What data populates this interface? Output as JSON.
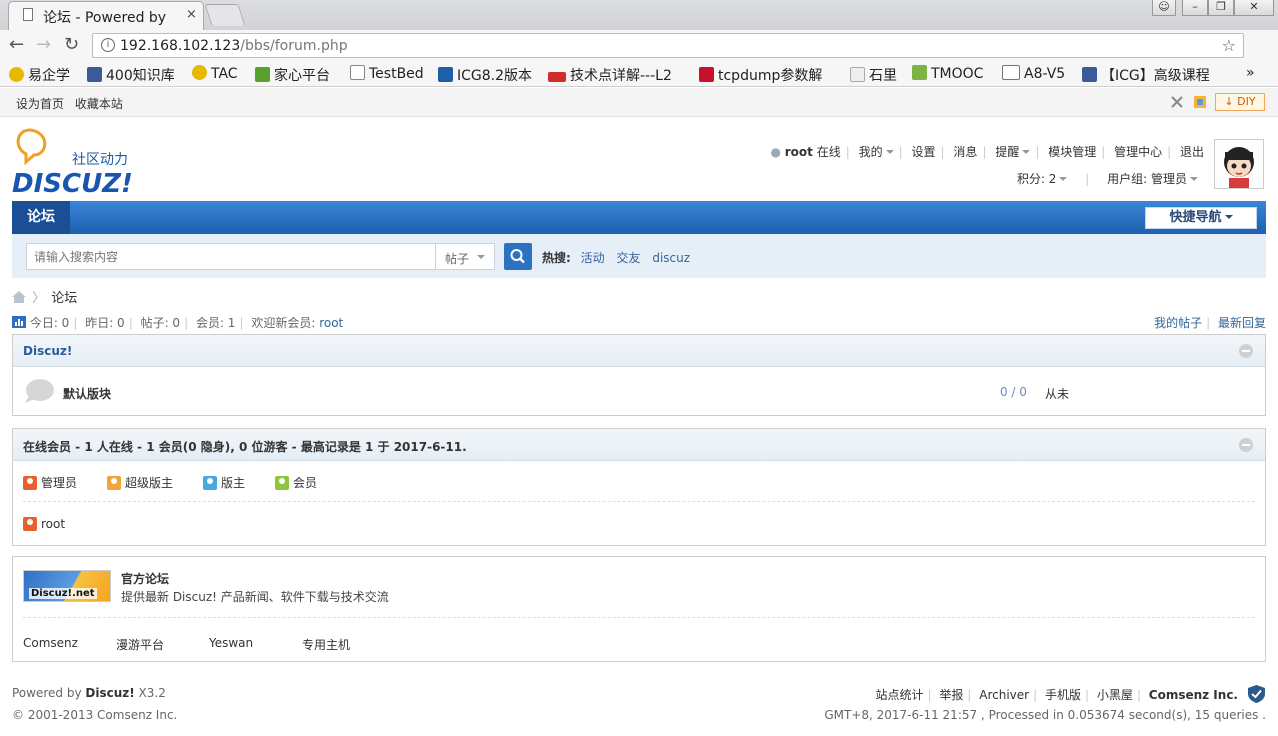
{
  "browser": {
    "tab_title": "论坛 - Powered by",
    "tab_close": "×",
    "url_host": "192.168.102.123",
    "url_path": "/bbs/forum.php",
    "bookmarks": [
      "易企学",
      "400知识库",
      "TAC",
      "家心平台",
      "TestBed",
      "ICG8.2版本",
      "技术点详解---L2",
      "tcpdump参数解",
      "石里",
      "TMOOC",
      "A8-V5",
      "【ICG】高级课程"
    ],
    "bookmark_more": "»"
  },
  "topstrip": {
    "set_home": "设为首页",
    "bookmark_site": "收藏本站",
    "diy": "DIY"
  },
  "logo": {
    "tagline": "社区动力",
    "wordmark": "DISCUZ!"
  },
  "user_nav": {
    "username": "root",
    "online": "在线",
    "items": [
      "我的",
      "设置",
      "消息",
      "提醒",
      "模块管理",
      "管理中心",
      "退出"
    ],
    "credits": "积分: 2",
    "usergroup": "用户组: 管理员"
  },
  "navbar": {
    "current": "论坛",
    "quick_nav": "快捷导航"
  },
  "search": {
    "placeholder": "请输入搜索内容",
    "type": "帖子",
    "hot_label": "热搜:",
    "hot": [
      "活动",
      "交友",
      "discuz"
    ]
  },
  "breadcrumb": {
    "current": "论坛",
    "sep": "〉"
  },
  "stats": {
    "today": "今日: 0",
    "yesterday": "昨日: 0",
    "posts": "帖子: 0",
    "members": "会员: 1",
    "new_member_label": "欢迎新会员: ",
    "new_member": "root"
  },
  "right_links": [
    "我的帖子",
    "最新回复"
  ],
  "category": {
    "title": "Discuz!",
    "forum_name": "默认版块",
    "forum_count": "0 / 0",
    "forum_last": "从未"
  },
  "online": {
    "title": "在线会员 - 1 人在线 - 1 会员(0 隐身), 0 位游客 - 最高记录是 1 于 2017-6-11.",
    "legend": [
      {
        "label": "管理员",
        "color": "#e8602c"
      },
      {
        "label": "超级版主",
        "color": "#f0a43a"
      },
      {
        "label": "版主",
        "color": "#49a8e0"
      },
      {
        "label": "会员",
        "color": "#8cc63e"
      }
    ],
    "member": "root"
  },
  "links": {
    "banner_text": "Discuz!.net",
    "title": "官方论坛",
    "desc": "提供最新 Discuz! 产品新闻、软件下载与技术交流",
    "friends": [
      "Comsenz",
      "漫游平台",
      "Yeswan",
      "专用主机"
    ]
  },
  "footer": {
    "powered_prefix": "Powered by ",
    "powered_name": "Discuz!",
    "version": " X3.2",
    "copyright": "© 2001-2013 Comsenz Inc.",
    "links": [
      "站点统计",
      "举报",
      "Archiver",
      "手机版",
      "小黑屋"
    ],
    "company": "Comsenz Inc.",
    "processed": "GMT+8, 2017-6-11 21:57 , Processed in 0.053674 second(s), 15 queries ."
  },
  "colors": {
    "nav_blue": "#1e5fb1",
    "link_blue": "#336699",
    "accent_orange": "#f0a75a"
  }
}
